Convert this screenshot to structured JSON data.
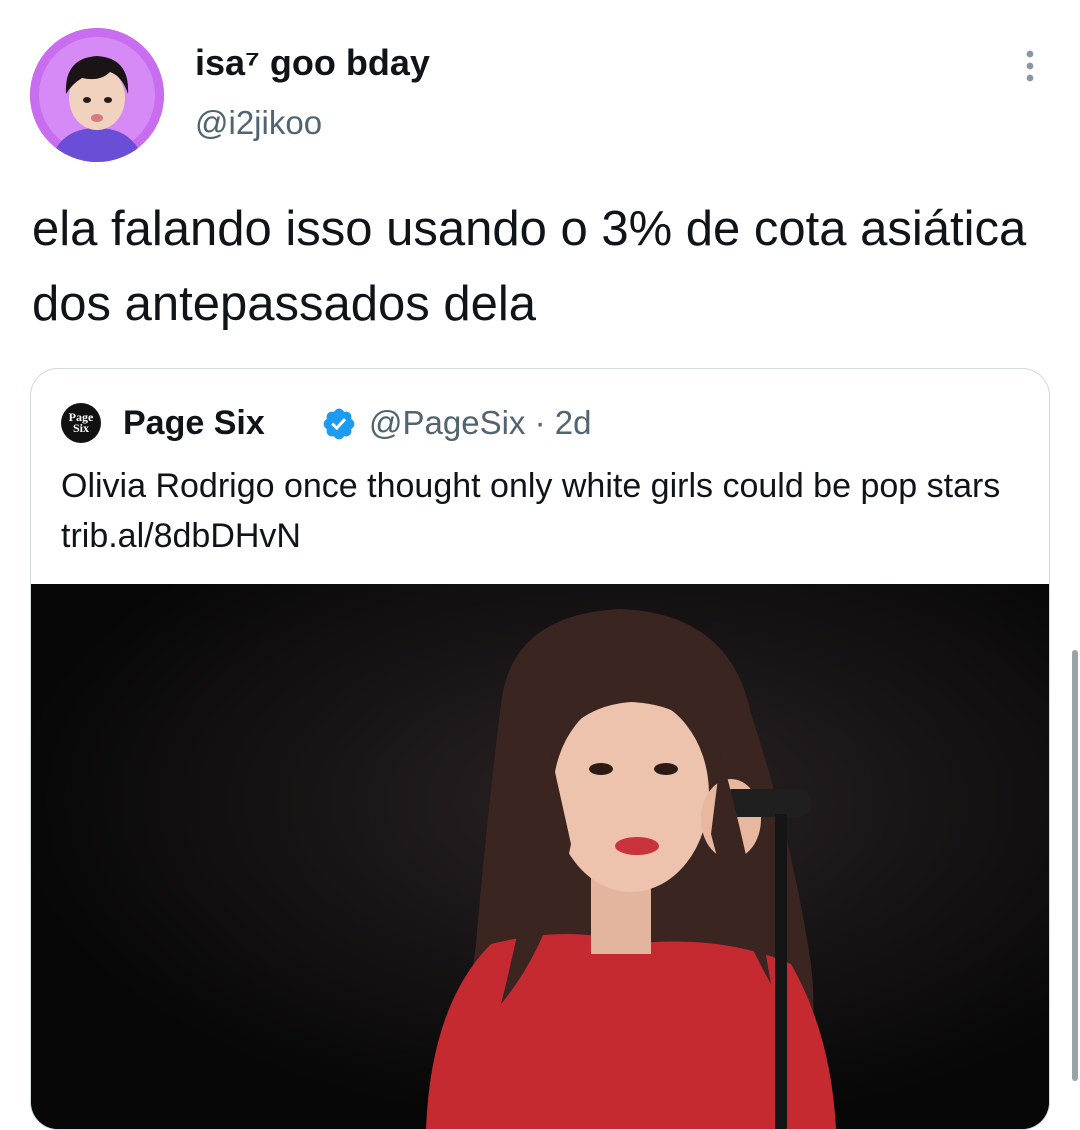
{
  "tweet": {
    "author_name": "isa⁷ goo bday",
    "author_handle": "@i2jikoo",
    "text": "ela falando isso usando o 3% de cota asiática dos antepassados dela",
    "avatar_icon": "avatar-photo",
    "more_icon": "more-options-icon"
  },
  "quoted_tweet": {
    "logo_line1": "Page",
    "logo_line2": "Six",
    "author_name": "Page Six",
    "verified_icon": "verified-badge-icon",
    "author_handle": "@PageSix",
    "separator": "·",
    "time": "2d",
    "text": "Olivia Rodrigo once thought only white girls could be pop stars trib.al/8dbDHvN",
    "media": "photo"
  },
  "colors": {
    "text_primary": "#0f1419",
    "text_secondary": "#536471",
    "verified_blue": "#1d9bf0",
    "card_border": "#cfd9de",
    "avatar_bg": "#c86df0"
  }
}
